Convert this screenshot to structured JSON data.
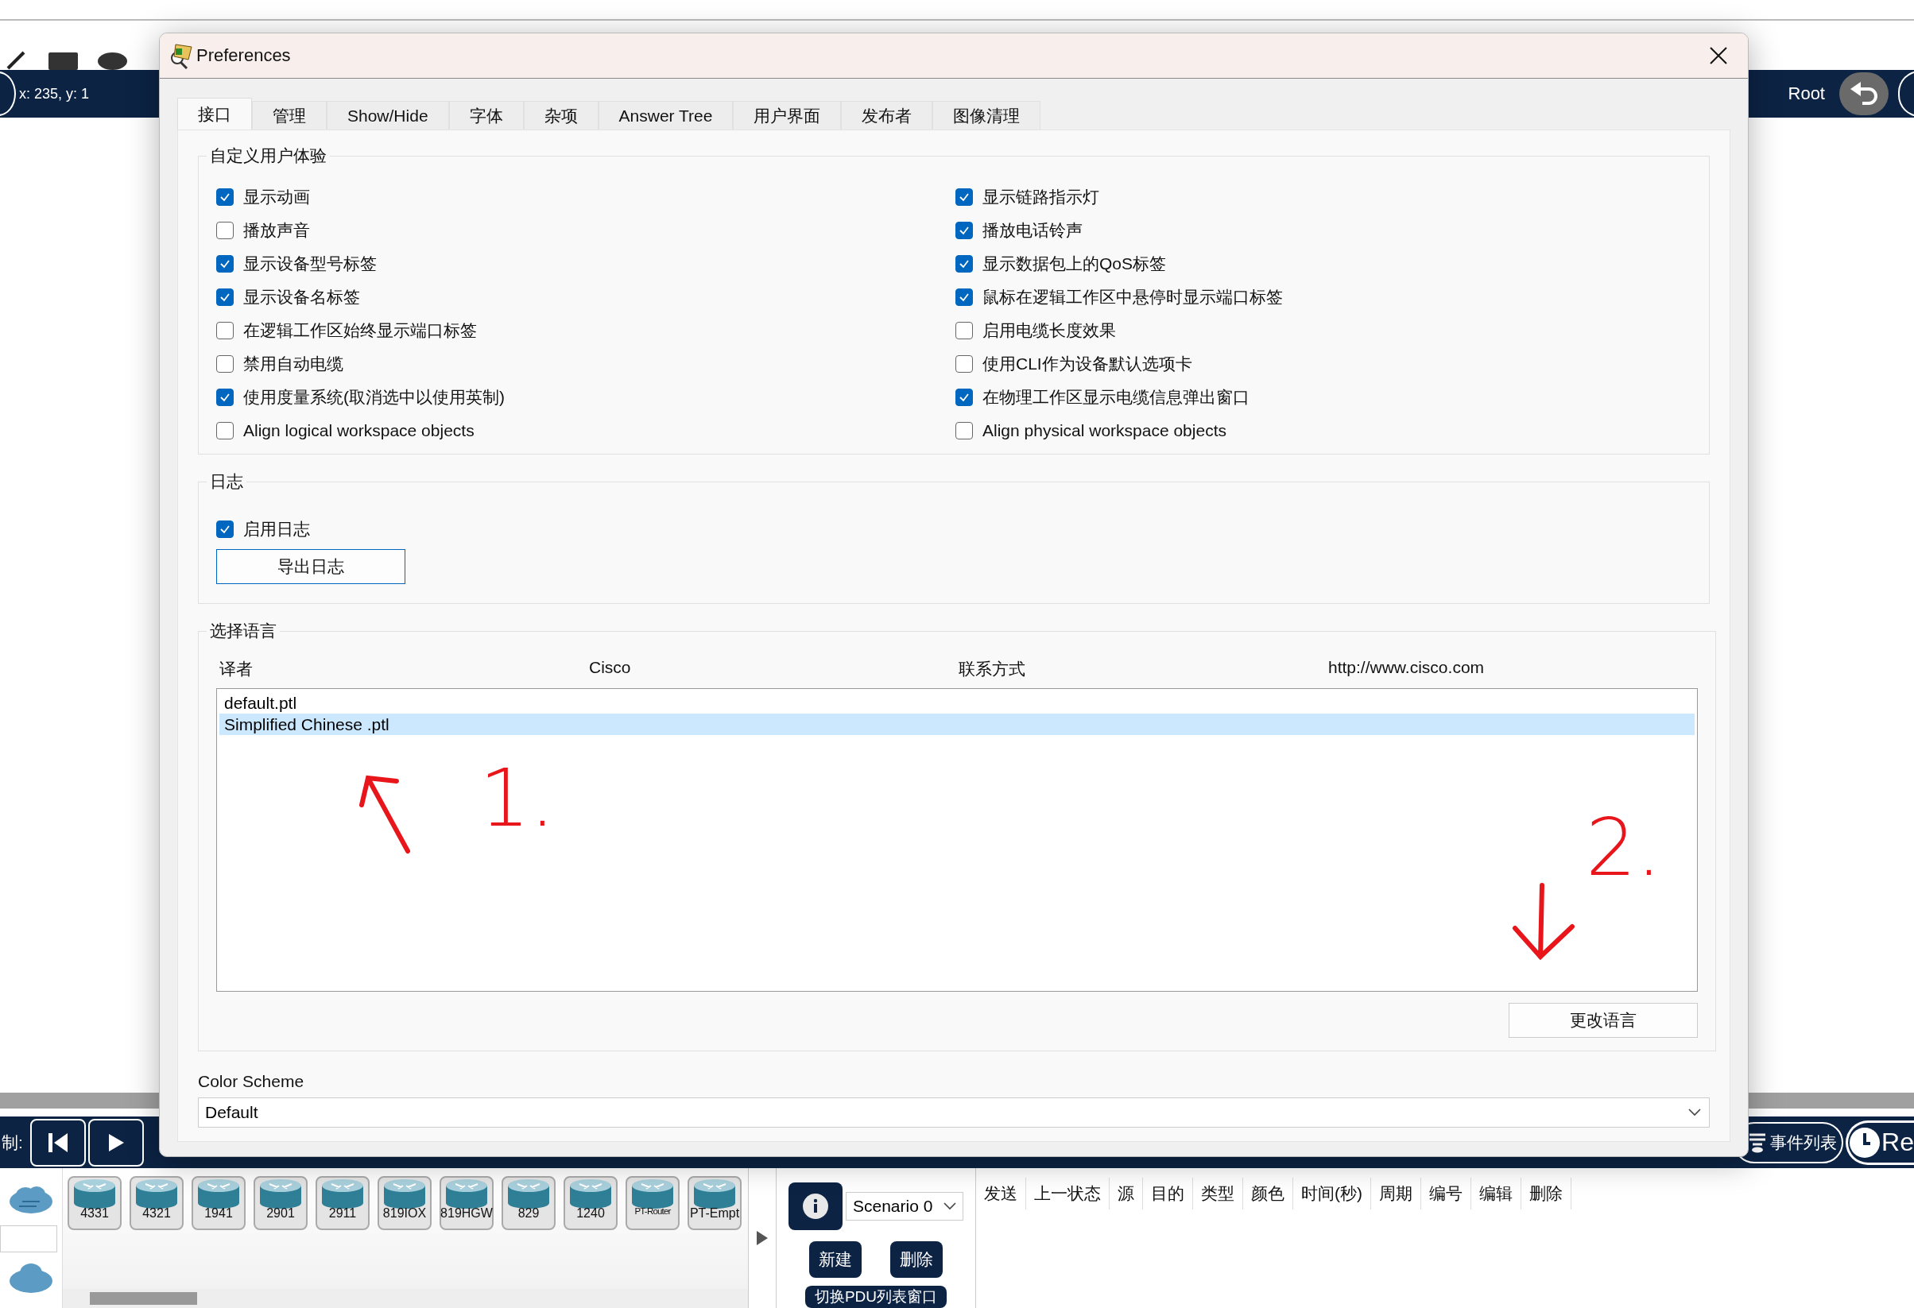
{
  "toolbar": {
    "coordinates": "x: 235, y: 1",
    "root_label": "Root"
  },
  "simulation_bar": {
    "control_label": "制:",
    "event_list_button": "事件列表",
    "realtime_button": "Re"
  },
  "device_panel": {
    "devices": [
      "4331",
      "4321",
      "1941",
      "2901",
      "2911",
      "819IOX",
      "819HGW",
      "829",
      "1240",
      "PT-Router",
      "PT-Empt"
    ]
  },
  "scenario_panel": {
    "scenario": "Scenario 0",
    "new_button": "新建",
    "delete_button": "删除",
    "toggle_button": "切换PDU列表窗口"
  },
  "pdu_table": {
    "columns": [
      "发送",
      "上一状态",
      "源",
      "目的",
      "类型",
      "颜色",
      "时间(秒)",
      "周期",
      "编号",
      "编辑",
      "删除"
    ]
  },
  "dialog": {
    "title": "Preferences",
    "tabs": [
      {
        "label": "接口",
        "selected": true
      },
      {
        "label": "管理",
        "selected": false
      },
      {
        "label": "Show/Hide",
        "selected": false
      },
      {
        "label": "字体",
        "selected": false
      },
      {
        "label": "杂项",
        "selected": false
      },
      {
        "label": "Answer Tree",
        "selected": false
      },
      {
        "label": "用户界面",
        "selected": false
      },
      {
        "label": "发布者",
        "selected": false
      },
      {
        "label": "图像清理",
        "selected": false
      }
    ],
    "ux_group": {
      "title": "自定义用户体验",
      "options": [
        {
          "label": "显示动画",
          "checked": true
        },
        {
          "label": "显示链路指示灯",
          "checked": true
        },
        {
          "label": "播放声音",
          "checked": false
        },
        {
          "label": "播放电话铃声",
          "checked": true
        },
        {
          "label": "显示设备型号标签",
          "checked": true
        },
        {
          "label": "显示数据包上的QoS标签",
          "checked": true
        },
        {
          "label": "显示设备名标签",
          "checked": true
        },
        {
          "label": "鼠标在逻辑工作区中悬停时显示端口标签",
          "checked": true
        },
        {
          "label": "在逻辑工作区始终显示端口标签",
          "checked": false
        },
        {
          "label": "启用电缆长度效果",
          "checked": false
        },
        {
          "label": "禁用自动电缆",
          "checked": false
        },
        {
          "label": "使用CLI作为设备默认选项卡",
          "checked": false
        },
        {
          "label": "使用度量系统(取消选中以使用英制)",
          "checked": true
        },
        {
          "label": "在物理工作区显示电缆信息弹出窗口",
          "checked": true
        },
        {
          "label": "Align logical workspace objects",
          "checked": false
        },
        {
          "label": "Align physical workspace objects",
          "checked": false
        }
      ]
    },
    "log_group": {
      "title": "日志",
      "options": [
        {
          "label": "启用日志",
          "checked": true
        }
      ],
      "export_button": "导出日志"
    },
    "language_group": {
      "title": "选择语言",
      "info": [
        "译者",
        "Cisco",
        "联系方式",
        "http://www.cisco.com"
      ],
      "languages": [
        {
          "label": "default.ptl",
          "selected": false
        },
        {
          "label": "Simplified Chinese .ptl",
          "selected": true
        }
      ],
      "change_button": "更改语言"
    },
    "color_scheme": {
      "label": "Color Scheme",
      "value": "Default"
    }
  },
  "annotations": [
    {
      "kind": "up",
      "number": "1."
    },
    {
      "kind": "down",
      "number": "2."
    }
  ]
}
